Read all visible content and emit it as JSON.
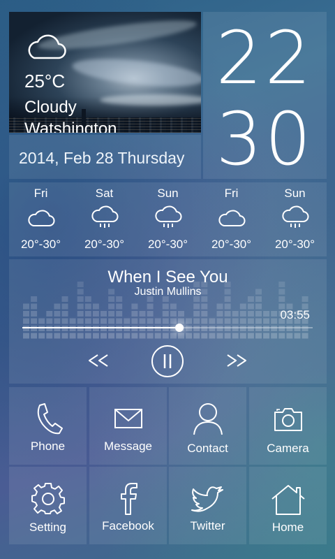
{
  "weather": {
    "icon": "cloud-icon",
    "temperature": "25°C",
    "condition": "Cloudy",
    "city": "Watshington"
  },
  "date": {
    "text": "2014, Feb 28  Thursday"
  },
  "clock": {
    "hours": "22",
    "minutes": "30"
  },
  "forecast": [
    {
      "day": "Fri",
      "icon": "cloud-icon",
      "range": "20°-30°"
    },
    {
      "day": "Sat",
      "icon": "rain-cloud-icon",
      "range": "20°-30°"
    },
    {
      "day": "Sun",
      "icon": "rain-cloud-icon",
      "range": "20°-30°"
    },
    {
      "day": "Fri",
      "icon": "cloud-icon",
      "range": "20°-30°"
    },
    {
      "day": "Sun",
      "icon": "rain-cloud-icon",
      "range": "20°-30°"
    }
  ],
  "player": {
    "song": "When I See You",
    "artist": "Justin Mullins",
    "duration": "03:55",
    "progress": 0.54,
    "controls": [
      "rewind-icon",
      "pause-icon",
      "fast-forward-icon"
    ]
  },
  "apps": [
    {
      "label": "Phone",
      "icon": "phone-icon"
    },
    {
      "label": "Message",
      "icon": "envelope-icon"
    },
    {
      "label": "Contact",
      "icon": "contact-person-icon"
    },
    {
      "label": "Camera",
      "icon": "camera-icon"
    },
    {
      "label": "Setting",
      "icon": "gear-icon"
    },
    {
      "label": "Facebook",
      "icon": "facebook-icon"
    },
    {
      "label": "Twitter",
      "icon": "twitter-bird-icon"
    },
    {
      "label": "Home",
      "icon": "home-icon"
    }
  ]
}
